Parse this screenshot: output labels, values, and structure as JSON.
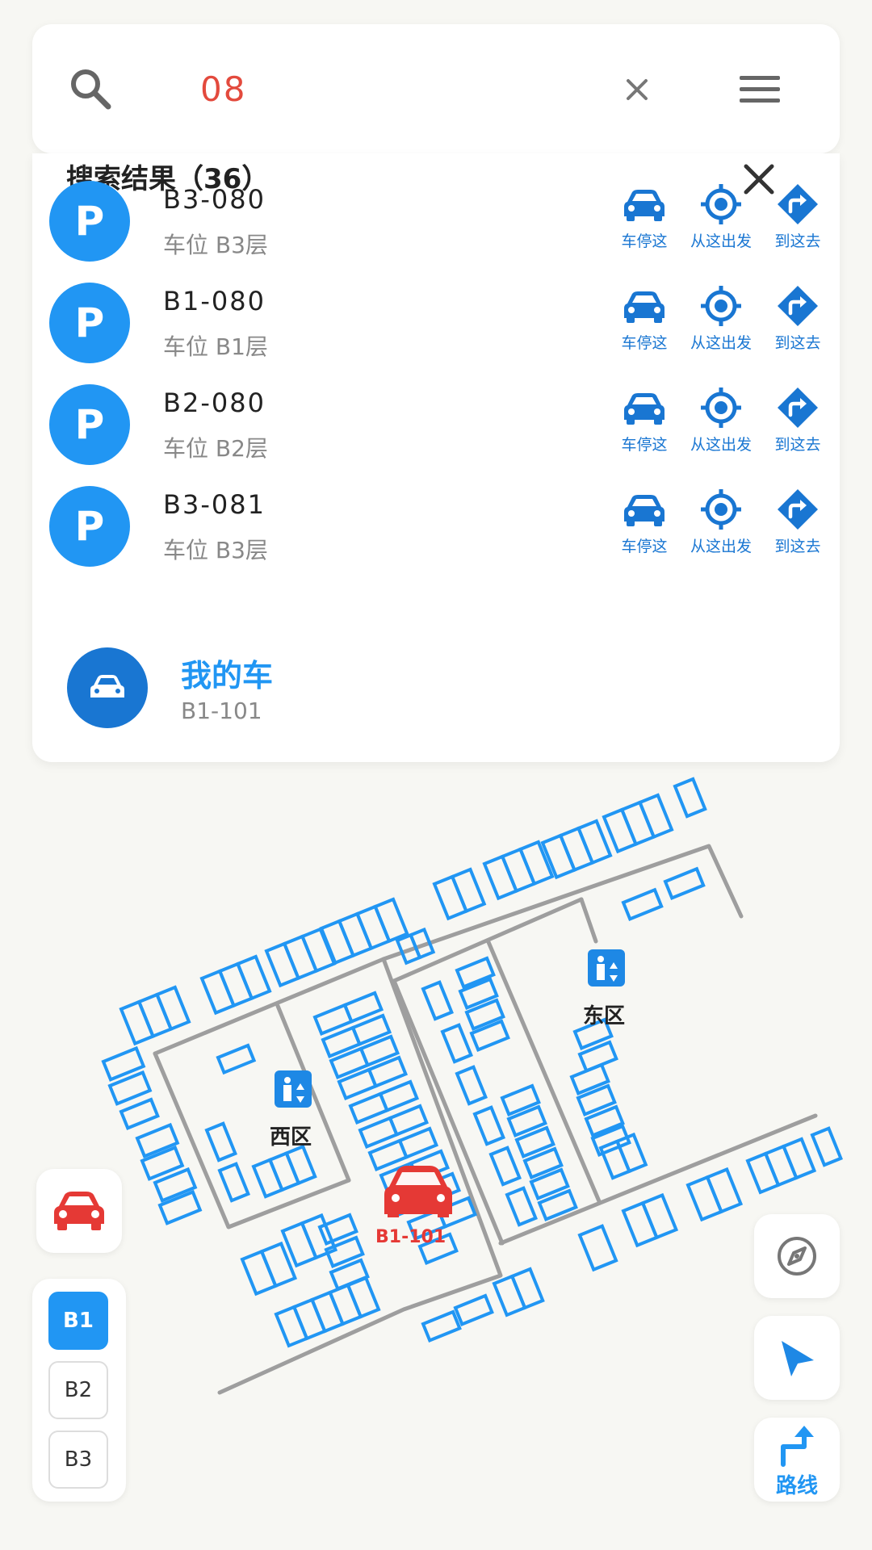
{
  "search": {
    "query": "08"
  },
  "results": {
    "title": "搜索结果（36）",
    "items": [
      {
        "title": "B3-080",
        "sub": "车位 B3层"
      },
      {
        "title": "B1-080",
        "sub": "车位 B1层"
      },
      {
        "title": "B2-080",
        "sub": "车位 B2层"
      },
      {
        "title": "B3-081",
        "sub": "车位 B3层"
      }
    ],
    "badge_letter": "P",
    "actions": {
      "park": "车停这",
      "from": "从这出发",
      "to": "到这去"
    },
    "my_car": {
      "title": "我的车",
      "spot": "B1-101"
    }
  },
  "map": {
    "zones": {
      "west": "西区",
      "east": "东区"
    },
    "car_marker": "B1-101"
  },
  "floors": [
    "B1",
    "B2",
    "B3"
  ],
  "active_floor": "B1",
  "route_label": "路线",
  "colors": {
    "accent": "#2196f3",
    "accent_dark": "#1976d2",
    "car_red": "#e53935",
    "query_red": "#e34a3d"
  }
}
